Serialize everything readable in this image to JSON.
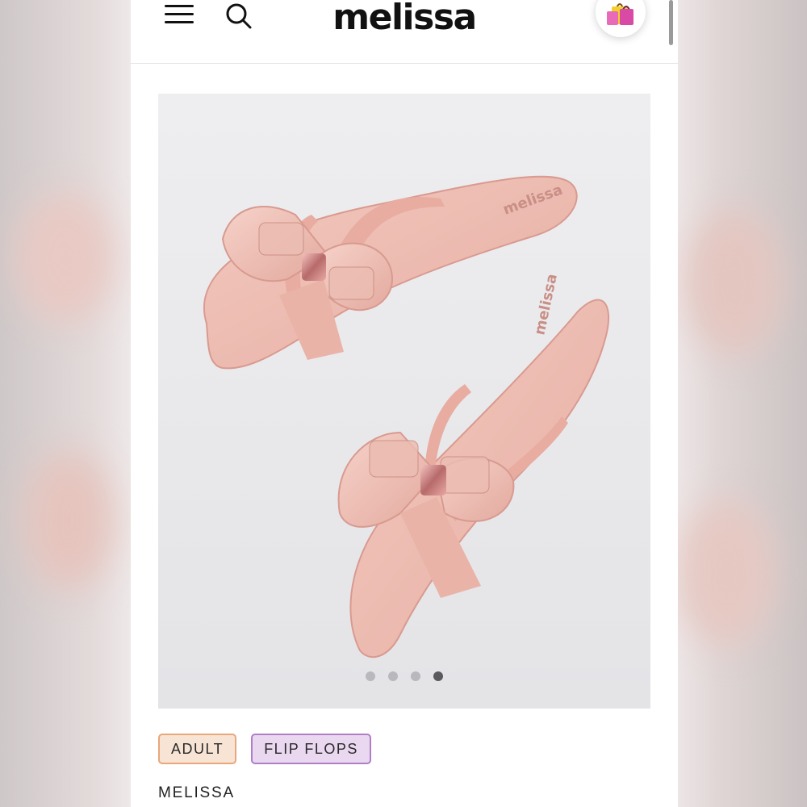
{
  "header": {
    "logo": "melissa",
    "menu_icon": "hamburger-menu-icon",
    "search_icon": "search-icon",
    "cart_icon": "shopping-bags-icon"
  },
  "gallery": {
    "image_alt": "Pink jelly flip flops with bow",
    "slide_count": 4,
    "active_slide": 4,
    "sole_print": "melissa"
  },
  "tags": [
    {
      "label": "ADULT",
      "color": "#f8e4d4",
      "border": "#e9a77b"
    },
    {
      "label": "FLIP FLOPS",
      "color": "#ead8f0",
      "border": "#b07ec7"
    }
  ],
  "product": {
    "brand": "MELISSA"
  },
  "colors": {
    "product_pink": "#efbfb4",
    "hardware_rose_gold": "#c97f7a",
    "image_background": "#e8e8eb"
  }
}
